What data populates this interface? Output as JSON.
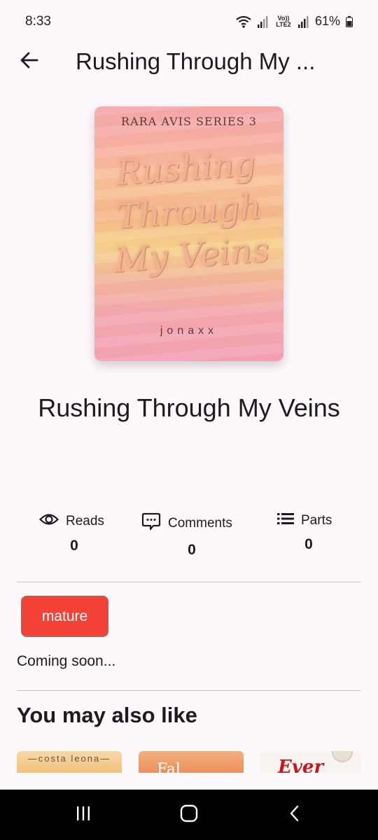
{
  "status_bar": {
    "time": "8:33",
    "volte_label": "Vo)) LTE2",
    "battery": "61%"
  },
  "app_bar": {
    "back_icon": "arrow-back-icon",
    "title": "Rushing Through My ..."
  },
  "cover": {
    "series": "RARA AVIS SERIES 3",
    "title": "Rushing Through My Veins",
    "author": "jonaxx"
  },
  "book": {
    "title": "Rushing Through My Veins"
  },
  "stats": {
    "reads": {
      "icon": "eye-icon",
      "label": "Reads",
      "value": "0"
    },
    "comments": {
      "icon": "comment-icon",
      "label": "Comments",
      "value": "0"
    },
    "parts": {
      "icon": "list-icon",
      "label": "Parts",
      "value": "0"
    }
  },
  "tag": {
    "label": "mature",
    "color": "#f44336"
  },
  "description": "Coming soon...",
  "recommendations": {
    "title": "You may also like",
    "items": [
      {
        "cover_text": "costa leona"
      },
      {
        "cover_text": "Fal"
      },
      {
        "cover_text": "Ever"
      }
    ]
  },
  "nav_bar": {
    "recents_icon": "recents-icon",
    "home_icon": "home-icon",
    "back_icon": "back-chevron-icon"
  },
  "colors": {
    "background": "#fcf8fb",
    "accent_tag": "#f44336",
    "divider": "#cac4d0"
  }
}
